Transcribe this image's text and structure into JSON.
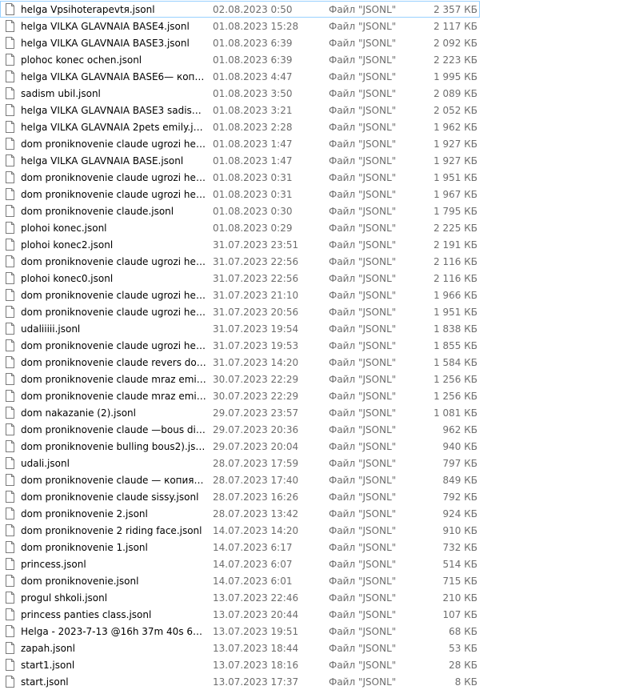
{
  "icons": {
    "file": "file-icon"
  },
  "colors": {
    "selection_border": "#99d1ff",
    "secondary_text": "#6d6d6d"
  },
  "files": [
    {
      "name": "helga Vpsihoterapevtя.jsonl",
      "date": "02.08.2023 0:50",
      "type": "Файл \"JSONL\"",
      "size": "2 357 КБ"
    },
    {
      "name": "helga VILKA GLAVNAIA BASE4.jsonl",
      "date": "01.08.2023 15:28",
      "type": "Файл \"JSONL\"",
      "size": "2 117 КБ"
    },
    {
      "name": "helga VILKA GLAVNAIA BASE3.jsonl",
      "date": "01.08.2023 6:39",
      "type": "Файл \"JSONL\"",
      "size": "2 092 КБ"
    },
    {
      "name": "plohoc konec ochen.jsonl",
      "date": "01.08.2023 6:39",
      "type": "Файл \"JSONL\"",
      "size": "2 223 КБ"
    },
    {
      "name": "helga VILKA GLAVNAIA BASE6— копия.js...",
      "date": "01.08.2023 4:47",
      "type": "Файл \"JSONL\"",
      "size": "1 995 КБ"
    },
    {
      "name": "sadism ubil.jsonl",
      "date": "01.08.2023 3:50",
      "type": "Файл \"JSONL\"",
      "size": "2 089 КБ"
    },
    {
      "name": "helga VILKA GLAVNAIA BASE3 sadism.jsonl",
      "date": "01.08.2023 3:21",
      "type": "Файл \"JSONL\"",
      "size": "2 052 КБ"
    },
    {
      "name": "helga VILKA GLAVNAIA 2pets emily.jsonl",
      "date": "01.08.2023 2:28",
      "type": "Файл \"JSONL\"",
      "size": "1 962 КБ"
    },
    {
      "name": "dom proniknovenie claude ugrozi helgi (...",
      "date": "01.08.2023 1:47",
      "type": "Файл \"JSONL\"",
      "size": "1 927 КБ"
    },
    {
      "name": "helga VILKA GLAVNAIA BASE.jsonl",
      "date": "01.08.2023 1:47",
      "type": "Файл \"JSONL\"",
      "size": "1 927 КБ"
    },
    {
      "name": "dom proniknovenie claude ugrozi helgi ...",
      "date": "01.08.2023 0:31",
      "type": "Файл \"JSONL\"",
      "size": "1 951 КБ"
    },
    {
      "name": "dom proniknovenie claude ugrozi helgi (...",
      "date": "01.08.2023 0:31",
      "type": "Файл \"JSONL\"",
      "size": "1 967 КБ"
    },
    {
      "name": "dom proniknovenie claude.jsonl",
      "date": "01.08.2023 0:30",
      "type": "Файл \"JSONL\"",
      "size": "1 795 КБ"
    },
    {
      "name": "plohoi konec.jsonl",
      "date": "01.08.2023 0:29",
      "type": "Файл \"JSONL\"",
      "size": "2 225 КБ"
    },
    {
      "name": "plohoi konec2.jsonl",
      "date": "31.07.2023 23:51",
      "type": "Файл \"JSONL\"",
      "size": "2 191 КБ"
    },
    {
      "name": "dom proniknovenie claude ugrozi helgi (...",
      "date": "31.07.2023 22:56",
      "type": "Файл \"JSONL\"",
      "size": "2 116 КБ"
    },
    {
      "name": "plohoi konec0.jsonl",
      "date": "31.07.2023 22:56",
      "type": "Файл \"JSONL\"",
      "size": "2 116 КБ"
    },
    {
      "name": "dom proniknovenie claude ugrozi helgi (...",
      "date": "31.07.2023 21:10",
      "type": "Файл \"JSONL\"",
      "size": "1 966 КБ"
    },
    {
      "name": "dom proniknovenie claude ugrozi helgi (...",
      "date": "31.07.2023 20:56",
      "type": "Файл \"JSONL\"",
      "size": "1 951 КБ"
    },
    {
      "name": "udaliiiii.jsonl",
      "date": "31.07.2023 19:54",
      "type": "Файл \"JSONL\"",
      "size": "1 838 КБ"
    },
    {
      "name": "dom proniknovenie claude ugrozi helgi (...",
      "date": "31.07.2023 19:53",
      "type": "Файл \"JSONL\"",
      "size": "1 855 КБ"
    },
    {
      "name": "dom proniknovenie claude revers dom.js...",
      "date": "31.07.2023 14:20",
      "type": "Файл \"JSONL\"",
      "size": "1 584 КБ"
    },
    {
      "name": "dom proniknovenie claude mraz emily fr...",
      "date": "30.07.2023 22:29",
      "type": "Файл \"JSONL\"",
      "size": "1 256 КБ"
    },
    {
      "name": "dom proniknovenie claude mraz emily fr...",
      "date": "30.07.2023 22:29",
      "type": "Файл \"JSONL\"",
      "size": "1 256 КБ"
    },
    {
      "name": "dom nakazanie (2).jsonl",
      "date": "29.07.2023 23:57",
      "type": "Файл \"JSONL\"",
      "size": "1 081 КБ"
    },
    {
      "name": "dom proniknovenie claude —bous discip...",
      "date": "29.07.2023 20:36",
      "type": "Файл \"JSONL\"",
      "size": "962 КБ"
    },
    {
      "name": "dom proniknovenie bulling bous2).jsonl",
      "date": "29.07.2023 20:04",
      "type": "Файл \"JSONL\"",
      "size": "940 КБ"
    },
    {
      "name": "udali.jsonl",
      "date": "28.07.2023 17:59",
      "type": "Файл \"JSONL\"",
      "size": "797 КБ"
    },
    {
      "name": "dom proniknovenie claude — копия.jsonl",
      "date": "28.07.2023 17:40",
      "type": "Файл \"JSONL\"",
      "size": "849 КБ"
    },
    {
      "name": "dom proniknovenie claude sissy.jsonl",
      "date": "28.07.2023 16:26",
      "type": "Файл \"JSONL\"",
      "size": "792 КБ"
    },
    {
      "name": "dom proniknovenie 2.jsonl",
      "date": "28.07.2023 13:42",
      "type": "Файл \"JSONL\"",
      "size": "924 КБ"
    },
    {
      "name": "dom proniknovenie 2 riding face.jsonl",
      "date": "14.07.2023 14:20",
      "type": "Файл \"JSONL\"",
      "size": "910 КБ"
    },
    {
      "name": "dom proniknovenie 1.jsonl",
      "date": "14.07.2023 6:17",
      "type": "Файл \"JSONL\"",
      "size": "732 КБ"
    },
    {
      "name": "princess.jsonl",
      "date": "14.07.2023 6:07",
      "type": "Файл \"JSONL\"",
      "size": "514 КБ"
    },
    {
      "name": "dom proniknovenie.jsonl",
      "date": "14.07.2023 6:01",
      "type": "Файл \"JSONL\"",
      "size": "715 КБ"
    },
    {
      "name": "progul shkoli.jsonl",
      "date": "13.07.2023 22:46",
      "type": "Файл \"JSONL\"",
      "size": "210 КБ"
    },
    {
      "name": "princess panties class.jsonl",
      "date": "13.07.2023 20:44",
      "type": "Файл \"JSONL\"",
      "size": "107 КБ"
    },
    {
      "name": "Helga - 2023-7-13 @16h 37m 40s 682ms.j...",
      "date": "13.07.2023 19:51",
      "type": "Файл \"JSONL\"",
      "size": "68 КБ"
    },
    {
      "name": "zapah.jsonl",
      "date": "13.07.2023 18:44",
      "type": "Файл \"JSONL\"",
      "size": "53 КБ"
    },
    {
      "name": "start1.jsonl",
      "date": "13.07.2023 18:16",
      "type": "Файл \"JSONL\"",
      "size": "28 КБ"
    },
    {
      "name": "start.jsonl",
      "date": "13.07.2023 17:37",
      "type": "Файл \"JSONL\"",
      "size": "8 КБ"
    }
  ]
}
